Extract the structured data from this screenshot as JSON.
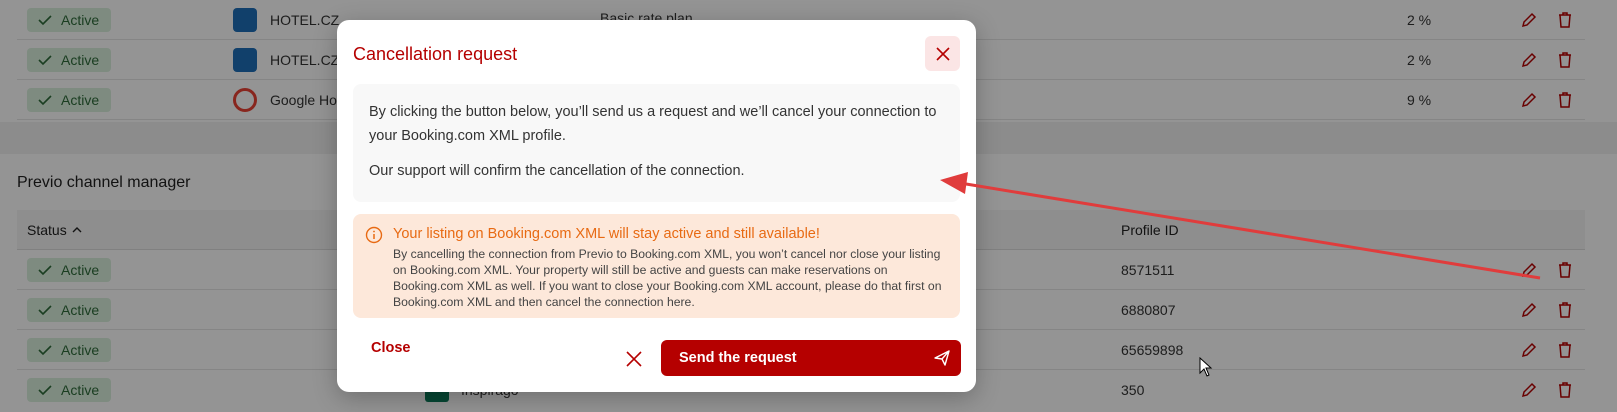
{
  "background": {
    "top_rows": [
      {
        "status": "Active",
        "channel": "HOTEL.CZ",
        "percent": "2 %"
      },
      {
        "status": "Active",
        "channel": "HOTEL.CZ",
        "percent": "2 %"
      },
      {
        "status": "Active",
        "channel": "Google Hot",
        "percent": "9 %"
      }
    ],
    "partial_text": "Basic rate plan",
    "section_title": "Previo channel manager",
    "table_header": {
      "status": "Status",
      "profile_id": "Profile ID"
    },
    "cm_rows": [
      {
        "status": "Active",
        "profile_id": "8571511"
      },
      {
        "status": "Active",
        "profile_id": "6880807"
      },
      {
        "status": "Active",
        "profile_id": "65659898"
      },
      {
        "status": "Active",
        "profile_id": "350",
        "channel": "Inspirago"
      }
    ]
  },
  "modal": {
    "title": "Cancellation request",
    "info_p1": "By clicking the button below, you’ll send us a request and we’ll cancel your connection to your Booking.com XML profile.",
    "info_p2": "Our support will confirm the cancellation of the connection.",
    "warning_title": "Your listing on Booking.com XML will stay active and still available!",
    "warning_text": "By cancelling the connection from Previo to Booking.com XML, you won’t cancel nor close your listing on Booking.com XML. Your property will still be active and guests can make reservations on Booking.com XML as well. If you want to close your Booking.com XML account, please do that first on Booking.com XML and then cancel the connection here.",
    "close_label": "Close",
    "send_label": "Send the request"
  },
  "colors": {
    "brand_red": "#b50000",
    "warning_orange": "#e86a13",
    "warning_bg": "#fde8da",
    "active_green": "#2e6b3a",
    "annotation_arrow": "#e03c3c"
  }
}
